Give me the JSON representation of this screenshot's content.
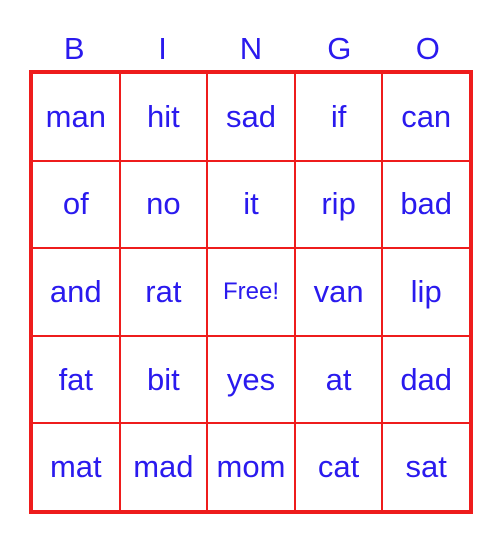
{
  "header": [
    "B",
    "I",
    "N",
    "G",
    "O"
  ],
  "cells": [
    [
      "man",
      "hit",
      "sad",
      "if",
      "can"
    ],
    [
      "of",
      "no",
      "it",
      "rip",
      "bad"
    ],
    [
      "and",
      "rat",
      "Free!",
      "van",
      "lip"
    ],
    [
      "fat",
      "bit",
      "yes",
      "at",
      "dad"
    ],
    [
      "mat",
      "mad",
      "mom",
      "cat",
      "sat"
    ]
  ],
  "colors": {
    "grid": "#ee1c1c",
    "text": "#2a1aee"
  }
}
